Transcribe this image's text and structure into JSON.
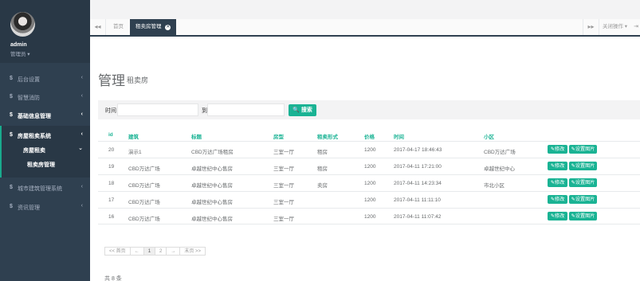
{
  "sidebar": {
    "user_name": "admin",
    "user_role": "管理员 ▾",
    "items": [
      {
        "label": "后台设置",
        "dollar": "$",
        "chev": "‹"
      },
      {
        "label": "智慧消防",
        "dollar": "$",
        "chev": "‹"
      },
      {
        "label": "基础信息管理",
        "dollar": "$",
        "chev": "‹"
      },
      {
        "label": "房屋租卖系统",
        "dollar": "$",
        "chev": "‹"
      },
      {
        "label": "城市建筑管理系统",
        "dollar": "$",
        "chev": "‹"
      },
      {
        "label": "资讯管理",
        "dollar": "$",
        "chev": "‹"
      }
    ],
    "sub_group": {
      "label": "房屋租卖",
      "chev": "⌄"
    },
    "sub_item": "租卖房管理"
  },
  "tabs": {
    "back": "◂◂",
    "forward": "▸▸",
    "items": [
      {
        "label": "首页"
      },
      {
        "label": "租卖房管理",
        "close": "✕"
      }
    ],
    "close_ops": "关闭操作 ▾",
    "exit": "⇥"
  },
  "page": {
    "title": "管理",
    "subtitle": "租卖房"
  },
  "search": {
    "time_label": "时间",
    "to_label": "到",
    "from_value": "",
    "to_value": "",
    "button": "🔍 搜索"
  },
  "table": {
    "columns": [
      "id",
      "建筑",
      "标题",
      "房型",
      "租卖形式",
      "价格",
      "时间",
      "小区"
    ],
    "edit_label": "✎修改",
    "image_label": "✎设置图片",
    "rows": [
      {
        "id": "20",
        "building": "演示1",
        "title": "CBD万达广场租房",
        "type": "三室一厅",
        "mode": "租房",
        "price": "1200",
        "time": "2017-04-17 18:46:43",
        "community": "CBD万达广场"
      },
      {
        "id": "19",
        "building": "CBD万达广场",
        "title": "卓越世纪中心售房",
        "type": "三室一厅",
        "mode": "租房",
        "price": "1200",
        "time": "2017-04-11 17:21:00",
        "community": "卓越世纪中心"
      },
      {
        "id": "18",
        "building": "CBD万达广场",
        "title": "卓越世纪中心售房",
        "type": "三室一厅",
        "mode": "卖房",
        "price": "1200",
        "time": "2017-04-11 14:23:34",
        "community": "市北小区"
      },
      {
        "id": "17",
        "building": "CBD万达广场",
        "title": "卓越世纪中心售房",
        "type": "三室一厅",
        "mode": "",
        "price": "1200",
        "time": "2017-04-11 11:11:10",
        "community": ""
      },
      {
        "id": "16",
        "building": "CBD万达广场",
        "title": "卓越世纪中心售房",
        "type": "三室一厅",
        "mode": "",
        "price": "1200",
        "time": "2017-04-11 11:07:42",
        "community": ""
      }
    ]
  },
  "pager": {
    "first": "<< 首页",
    "prev": "←",
    "pages": [
      "1",
      "2"
    ],
    "next": "→",
    "last": "末页 >>"
  },
  "footer": {
    "total": "共 8 条"
  }
}
